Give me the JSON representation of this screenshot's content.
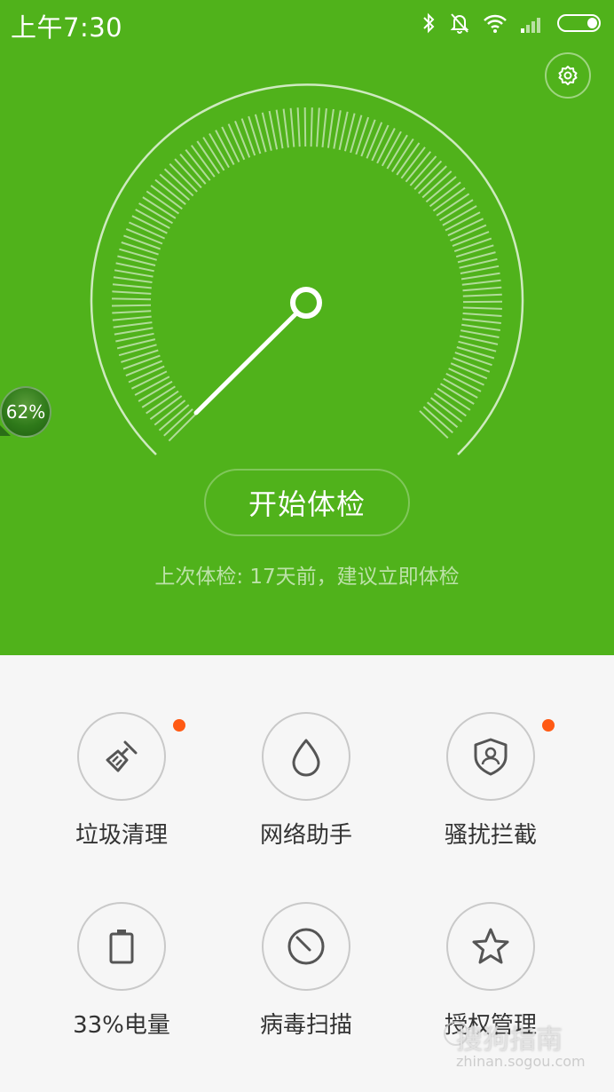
{
  "status_bar": {
    "time": "上午7:30",
    "icons": [
      "bluetooth-icon",
      "mute-bell-icon",
      "wifi-icon",
      "signal-icon",
      "battery-icon"
    ]
  },
  "colors": {
    "primary_green": "#50b21b",
    "badge_orange": "#ff5a14",
    "bottom_background": "#f6f6f6"
  },
  "header": {
    "settings_icon": "gear-icon"
  },
  "float_ball": {
    "percent": "62%"
  },
  "checkup": {
    "start_label": "开始体检",
    "last_check": "上次体检: 17天前，建议立即体检"
  },
  "tools": [
    {
      "label": "垃圾清理",
      "icon": "broom-icon",
      "badge": true
    },
    {
      "label": "网络助手",
      "icon": "droplet-icon",
      "badge": false
    },
    {
      "label": "骚扰拦截",
      "icon": "shield-user-icon",
      "badge": true
    },
    {
      "label": "33%电量",
      "icon": "battery-icon",
      "badge": false
    },
    {
      "label": "病毒扫描",
      "icon": "scan-dial-icon",
      "badge": false
    },
    {
      "label": "授权管理",
      "icon": "star-icon",
      "badge": false
    }
  ],
  "watermark": {
    "main": "搜狗指南",
    "sub": "zhinan.sogou.com"
  }
}
